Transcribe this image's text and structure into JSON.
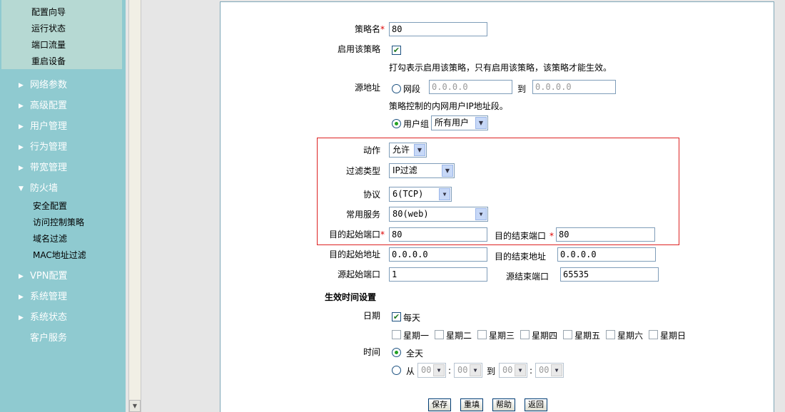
{
  "sidebar": {
    "top_items": [
      "配置向导",
      "运行状态",
      "端口流量",
      "重启设备"
    ],
    "menu": [
      {
        "label": "网络参数",
        "expanded": false
      },
      {
        "label": "高级配置",
        "expanded": false
      },
      {
        "label": "用户管理",
        "expanded": false
      },
      {
        "label": "行为管理",
        "expanded": false
      },
      {
        "label": "带宽管理",
        "expanded": false
      },
      {
        "label": "防火墙",
        "expanded": true
      }
    ],
    "firewall_items": [
      "安全配置",
      "访问控制策略",
      "域名过滤",
      "MAC地址过滤"
    ],
    "menu_after": [
      {
        "label": "VPN配置"
      },
      {
        "label": "系统管理"
      },
      {
        "label": "系统状态"
      },
      {
        "label": "客户服务"
      }
    ]
  },
  "form": {
    "policy_name_label": "策略名",
    "policy_name_value": "80",
    "enable_label": "启用该策略",
    "enable_checked": true,
    "enable_hint": "打勾表示启用该策略，只有启用该策略，该策略才能生效。",
    "source_label": "源地址",
    "segment_label": "网段",
    "segment_from": "0.0.0.0",
    "to_label": "到",
    "segment_to": "0.0.0.0",
    "source_hint": "策略控制的内网用户IP地址段。",
    "usergroup_label": "用户组",
    "usergroup_value": "所有用户",
    "action_label": "动作",
    "action_value": "允许",
    "filter_type_label": "过滤类型",
    "filter_type_value": "IP过滤",
    "protocol_label": "协议",
    "protocol_value": "6(TCP)",
    "service_label": "常用服务",
    "service_value": "80(web)",
    "dst_start_port_label": "目的起始端口",
    "dst_start_port_value": "80",
    "dst_end_port_label": "目的结束端口",
    "dst_end_port_value": "80",
    "dst_start_addr_label": "目的起始地址",
    "dst_start_addr_value": "0.0.0.0",
    "dst_end_addr_label": "目的结束地址",
    "dst_end_addr_value": "0.0.0.0",
    "src_start_port_label": "源起始端口",
    "src_start_port_value": "1",
    "src_end_port_label": "源结束端口",
    "src_end_port_value": "65535",
    "schedule_title": "生效时间设置",
    "date_label": "日期",
    "everyday_label": "每天",
    "weekdays": [
      "星期一",
      "星期二",
      "星期三",
      "星期四",
      "星期五",
      "星期六",
      "星期日"
    ],
    "time_label": "时间",
    "allday_label": "全天",
    "from_label": "从",
    "to2_label": "到",
    "time_placeholder": "00",
    "colon": ":",
    "required_mark": "*"
  },
  "buttons": {
    "save": "保存",
    "reset": "重填",
    "help": "帮助",
    "back": "返回"
  },
  "colors": {
    "sidebar_bg": "#8fcad0",
    "sidebar_sub_bg": "#b6d9d3",
    "highlight_border": "#dd2222",
    "required": "#dd0000"
  }
}
